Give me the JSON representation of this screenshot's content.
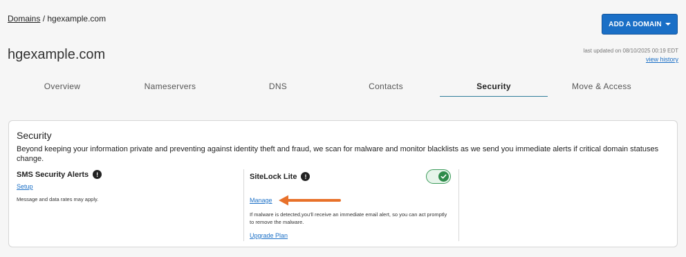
{
  "breadcrumb": {
    "parent": "Domains",
    "separator": " / ",
    "current": "hgexample.com"
  },
  "page_title": "hgexample.com",
  "add_domain_button": "ADD A DOMAIN",
  "last_updated": "last updated on 08/10/2025 00:19 EDT",
  "view_history": "view history",
  "tabs": [
    {
      "label": "Overview"
    },
    {
      "label": "Nameservers"
    },
    {
      "label": "DNS"
    },
    {
      "label": "Contacts"
    },
    {
      "label": "Security",
      "active": true
    },
    {
      "label": "Move & Access"
    }
  ],
  "security": {
    "title": "Security",
    "description": "Beyond keeping your information private and preventing against identity theft and fraud, we scan for malware and monitor blacklists as we send you immediate alerts if critical domain statuses change.",
    "sms": {
      "title": "SMS Security Alerts",
      "setup_link": "Setup",
      "note": "Message and data rates may apply."
    },
    "sitelock": {
      "title": "SiteLock Lite",
      "toggle_on": true,
      "manage_link": "Manage",
      "note": "If malware is detected,you'll receive an immediate email alert, so you can act promptly to remove the malware.",
      "upgrade_link": "Upgrade Plan"
    },
    "info_icon_glyph": "!"
  },
  "colors": {
    "accent": "#1a6fc6",
    "toggle": "#2e8b4a",
    "arrow": "#e8712a"
  },
  "icons": {
    "info": "exclamation-info-icon",
    "check": "check-icon",
    "caret": "caret-down-icon",
    "arrow": "left-arrow-icon"
  }
}
